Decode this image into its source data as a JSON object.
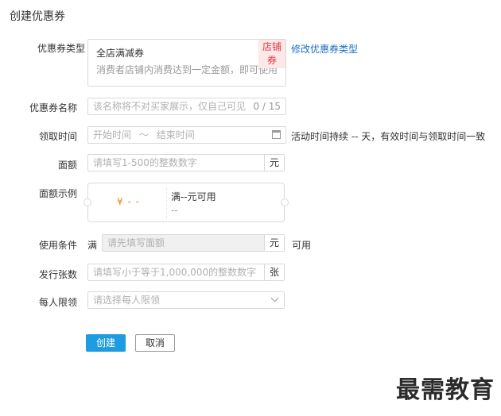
{
  "page": {
    "title": "创建优惠券"
  },
  "coupon_type": {
    "label": "优惠券类型",
    "name": "全店满减券",
    "description": "消费者店铺内消费达到一定金额，即可使用",
    "tag": "店铺券",
    "change_link": "修改优惠券类型"
  },
  "coupon_name": {
    "label": "优惠券名称",
    "placeholder": "该名称将不对买家展示，仅自己可见",
    "counter": "0 / 15"
  },
  "claim_time": {
    "label": "领取时间",
    "start_placeholder": "开始时间",
    "separator": "～",
    "end_placeholder": "结束时间",
    "hint": "活动时间持续 -- 天，有效时间与领取时间一致",
    "icon": "calendar-icon"
  },
  "face_value": {
    "label": "面额",
    "placeholder": "请填写1-500的整数数字",
    "unit": "元"
  },
  "example": {
    "label": "面额示例",
    "price": "¥ - -",
    "condition": "满--元可用",
    "sub": "--"
  },
  "usage_condition": {
    "label": "使用条件",
    "prefix": "满",
    "placeholder": "请先填写面额",
    "unit": "元",
    "suffix": "可用"
  },
  "issue_count": {
    "label": "发行张数",
    "placeholder": "请填写小于等于1,000,000的整数数字",
    "unit": "张"
  },
  "per_person_limit": {
    "label": "每人限领",
    "placeholder": "请选择每人限领",
    "icon": "chevron-down-icon"
  },
  "actions": {
    "create": "创建",
    "cancel": "取消"
  },
  "watermark": "最需教育",
  "colors": {
    "primary": "#1f9bdf",
    "link": "#1a6fc4",
    "tag_text": "#e4393c",
    "tag_bg": "#fde8e8",
    "price": "#e08a1e"
  }
}
